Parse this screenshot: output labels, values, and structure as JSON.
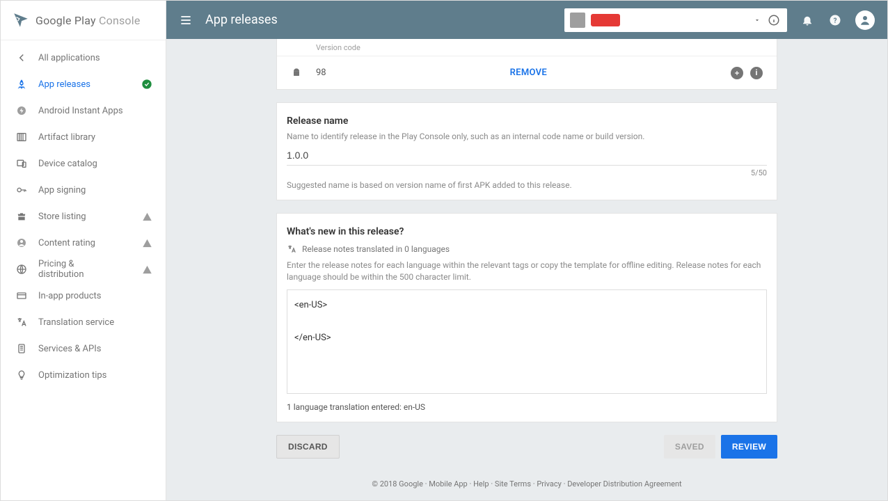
{
  "brand": {
    "name1": "Google Play ",
    "name2": "Console"
  },
  "topbar": {
    "title": "App releases"
  },
  "sidebar": {
    "all_apps": "All applications",
    "items": [
      {
        "label": "App releases",
        "icon": "rocket",
        "active": true,
        "status": "check"
      },
      {
        "label": "Android Instant Apps",
        "icon": "bolt",
        "active": false,
        "status": ""
      },
      {
        "label": "Artifact library",
        "icon": "library",
        "active": false,
        "status": ""
      },
      {
        "label": "Device catalog",
        "icon": "devices",
        "active": false,
        "status": ""
      },
      {
        "label": "App signing",
        "icon": "key",
        "active": false,
        "status": ""
      },
      {
        "label": "Store listing",
        "icon": "store",
        "active": false,
        "status": "warn"
      },
      {
        "label": "Content rating",
        "icon": "rating",
        "active": false,
        "status": "warn"
      },
      {
        "label": "Pricing & distribution",
        "icon": "globe",
        "active": false,
        "status": "warn"
      },
      {
        "label": "In-app products",
        "icon": "card",
        "active": false,
        "status": ""
      },
      {
        "label": "Translation service",
        "icon": "translate",
        "active": false,
        "status": ""
      },
      {
        "label": "Services & APIs",
        "icon": "services",
        "active": false,
        "status": ""
      },
      {
        "label": "Optimization tips",
        "icon": "bulb",
        "active": false,
        "status": ""
      }
    ]
  },
  "apk": {
    "header": "Version code",
    "code": "98",
    "remove": "REMOVE"
  },
  "release_name": {
    "title": "Release name",
    "subtitle": "Name to identify release in the Play Console only, such as an internal code name or build version.",
    "value": "1.0.0",
    "counter": "5/50",
    "hint": "Suggested name is based on version name of first APK added to this release."
  },
  "whats_new": {
    "title": "What's new in this release?",
    "translated_line": "Release notes translated in 0 languages",
    "subtitle": "Enter the release notes for each language within the relevant tags or copy the template for offline editing. Release notes for each language should be within the 500 character limit.",
    "value": "<en-US>\n\n</en-US>",
    "entered": "1 language translation entered: en-US"
  },
  "actions": {
    "discard": "DISCARD",
    "saved": "SAVED",
    "review": "REVIEW"
  },
  "footer": {
    "text": "© 2018 Google · Mobile App · Help · Site Terms · Privacy · Developer Distribution Agreement"
  }
}
